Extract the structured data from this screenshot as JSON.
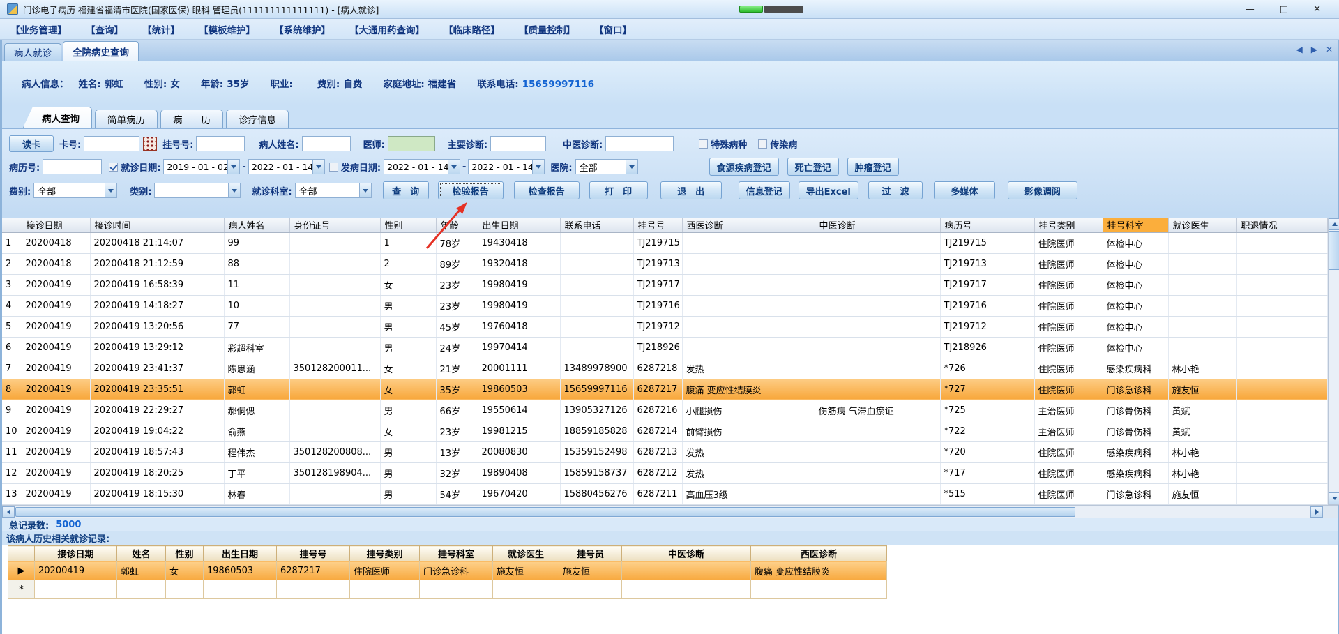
{
  "colors": {
    "selected_row": "#f8a73b",
    "header_highlight": "#fbae3c",
    "accent_navy": "#10357f",
    "link_blue": "#1464d2",
    "doctor_field_green": "#cfe8c4",
    "arrow_red": "#e53125"
  },
  "titlebar": {
    "title": "门诊电子病历 福建省福清市医院(国家医保) 眼科 管理员(111111111111111) - [病人就诊]",
    "minimize": "—",
    "maximize": "□",
    "close": "✕"
  },
  "menubar": {
    "items": [
      "【业务管理】",
      "【查询】",
      "【统计】",
      "【模板维护】",
      "【系统维护】",
      "【大通用药查询】",
      "【临床路径】",
      "【质量控制】",
      "【窗口】"
    ]
  },
  "outer_tabs": [
    {
      "label": "病人就诊",
      "active": false
    },
    {
      "label": "全院病史查询",
      "active": true
    }
  ],
  "tab_nav": {
    "left": "◀",
    "right": "▶",
    "close": "✕"
  },
  "patient_bar": {
    "prefix": "病人信息：",
    "fields": [
      {
        "label": "姓名:",
        "value": "郭虹"
      },
      {
        "label": "性别:",
        "value": "女"
      },
      {
        "label": "年龄:",
        "value": "35岁"
      },
      {
        "label": "职业:",
        "value": ""
      },
      {
        "label": "费别:",
        "value": "自费"
      },
      {
        "label": "家庭地址:",
        "value": "福建省"
      },
      {
        "label": "联系电话:",
        "value": "15659997116",
        "highlight": true
      }
    ]
  },
  "inner_tabs": [
    {
      "label": "病人查询",
      "active": true
    },
    {
      "label": "简单病历",
      "active": false
    },
    {
      "label": "病　　历",
      "active": false
    },
    {
      "label": "诊疗信息",
      "active": false
    }
  ],
  "form": {
    "read_card": "读卡",
    "card_no_label": "卡号:",
    "card_no_value": "",
    "reg_no_label": "挂号号:",
    "reg_no_value": "",
    "patient_name_label": "病人姓名:",
    "patient_name_value": "",
    "doctor_label": "医师:",
    "doctor_value": "",
    "main_diag_label": "主要诊断:",
    "main_diag_value": "",
    "tcm_diag_label": "中医诊断:",
    "tcm_diag_value": "",
    "special_disease": "特殊病种",
    "infectious": "传染病",
    "record_no_label": "病历号:",
    "record_no_value": "",
    "visit_date_label": "就诊日期:",
    "visit_from": "2019 - 01 - 02",
    "visit_to": "2022 - 01 - 14",
    "onset_date_label": "发病日期:",
    "onset_from": "2022 - 01 - 14",
    "onset_to": "2022 - 01 - 14",
    "hospital_label": "医院:",
    "hospital_value": "全部",
    "btn_foodborne": "食源疾病登记",
    "btn_death": "死亡登记",
    "btn_tumor": "肿瘤登记",
    "fee_label": "费别:",
    "fee_value": "全部",
    "type_label": "类别:",
    "type_value": "",
    "dept_label": "就诊科室:",
    "dept_value": "全部",
    "btn_query": "查　询",
    "btn_lab_report": "检验报告",
    "btn_exam_report": "检查报告",
    "btn_print": "打　印",
    "btn_exit": "退　出",
    "btn_info_reg": "信息登记",
    "btn_export": "导出Excel",
    "btn_filter": "过　滤",
    "btn_multimedia": "多媒体",
    "btn_imaging": "影像调阅"
  },
  "main_table": {
    "columns": [
      "",
      "接诊日期",
      "接诊时间",
      "病人姓名",
      "身份证号",
      "性别",
      "年龄",
      "出生日期",
      "联系电话",
      "挂号号",
      "西医诊断",
      "中医诊断",
      "病历号",
      "挂号类别",
      "挂号科室",
      "就诊医生",
      "职退情况"
    ],
    "highlight_column_index": 14,
    "selected_row_index": 7,
    "rows": [
      [
        "1",
        "20200418",
        "20200418 21:14:07",
        "99",
        "",
        "1",
        "78岁",
        "19430418",
        "",
        "TJ219715",
        "",
        "",
        "TJ219715",
        "住院医师",
        "体检中心",
        "",
        ""
      ],
      [
        "2",
        "20200418",
        "20200418 21:12:59",
        "88",
        "",
        "2",
        "89岁",
        "19320418",
        "",
        "TJ219713",
        "",
        "",
        "TJ219713",
        "住院医师",
        "体检中心",
        "",
        ""
      ],
      [
        "3",
        "20200419",
        "20200419 16:58:39",
        "11",
        "",
        "女",
        "23岁",
        "19980419",
        "",
        "TJ219717",
        "",
        "",
        "TJ219717",
        "住院医师",
        "体检中心",
        "",
        ""
      ],
      [
        "4",
        "20200419",
        "20200419 14:18:27",
        "10",
        "",
        "男",
        "23岁",
        "19980419",
        "",
        "TJ219716",
        "",
        "",
        "TJ219716",
        "住院医师",
        "体检中心",
        "",
        ""
      ],
      [
        "5",
        "20200419",
        "20200419 13:20:56",
        "77",
        "",
        "男",
        "45岁",
        "19760418",
        "",
        "TJ219712",
        "",
        "",
        "TJ219712",
        "住院医师",
        "体检中心",
        "",
        ""
      ],
      [
        "6",
        "20200419",
        "20200419 13:29:12",
        "彩超科室",
        "",
        "男",
        "24岁",
        "19970414",
        "",
        "TJ218926",
        "",
        "",
        "TJ218926",
        "住院医师",
        "体检中心",
        "",
        ""
      ],
      [
        "7",
        "20200419",
        "20200419 23:41:37",
        "陈思涵",
        "350128200011...",
        "女",
        "21岁",
        "20001111",
        "13489978900",
        "6287218",
        "发热",
        "",
        "*726",
        "住院医师",
        "感染疾病科",
        "林小艳",
        ""
      ],
      [
        "8",
        "20200419",
        "20200419 23:35:51",
        "郭虹",
        "",
        "女",
        "35岁",
        "19860503",
        "15659997116",
        "6287217",
        "腹痛 变应性结膜炎",
        "",
        "*727",
        "住院医师",
        "门诊急诊科",
        "施友恒",
        ""
      ],
      [
        "9",
        "20200419",
        "20200419 22:29:27",
        "郝侗偲",
        "",
        "男",
        "66岁",
        "19550614",
        "13905327126",
        "6287216",
        "小腿损伤",
        "伤筋病 气滞血瘀证",
        "*725",
        "主治医师",
        "门诊骨伤科",
        "黄斌",
        ""
      ],
      [
        "10",
        "20200419",
        "20200419 19:04:22",
        "俞燕",
        "",
        "女",
        "23岁",
        "19981215",
        "18859185828",
        "6287214",
        "前臂损伤",
        "",
        "*722",
        "主治医师",
        "门诊骨伤科",
        "黄斌",
        ""
      ],
      [
        "11",
        "20200419",
        "20200419 18:57:43",
        "程伟杰",
        "350128200808...",
        "男",
        "13岁",
        "20080830",
        "15359152498",
        "6287213",
        "发热",
        "",
        "*720",
        "住院医师",
        "感染疾病科",
        "林小艳",
        ""
      ],
      [
        "12",
        "20200419",
        "20200419 18:20:25",
        "丁平",
        "350128198904...",
        "男",
        "32岁",
        "19890408",
        "15859158737",
        "6287212",
        "发热",
        "",
        "*717",
        "住院医师",
        "感染疾病科",
        "林小艳",
        ""
      ],
      [
        "13",
        "20200419",
        "20200419 18:15:30",
        "林春",
        "",
        "男",
        "54岁",
        "19670420",
        "15880456276",
        "6287211",
        "高血压3级",
        "",
        "*515",
        "住院医师",
        "门诊急诊科",
        "施友恒",
        ""
      ]
    ]
  },
  "status": {
    "total_label": "总记录数:",
    "total_value": "5000",
    "history_label": "该病人历史相关就诊记录:"
  },
  "history_table": {
    "columns": [
      "",
      "接诊日期",
      "姓名",
      "性别",
      "出生日期",
      "挂号号",
      "挂号类别",
      "挂号科室",
      "就诊医生",
      "挂号员",
      "中医诊断",
      "西医诊断"
    ],
    "selected_row_index": 0,
    "rows": [
      [
        "▶",
        "20200419",
        "郭虹",
        "女",
        "19860503",
        "6287217",
        "住院医师",
        "门诊急诊科",
        "施友恒",
        "施友恒",
        "",
        "腹痛 变应性结膜炎"
      ],
      [
        "*",
        "",
        "",
        "",
        "",
        "",
        "",
        "",
        "",
        "",
        "",
        ""
      ]
    ]
  }
}
